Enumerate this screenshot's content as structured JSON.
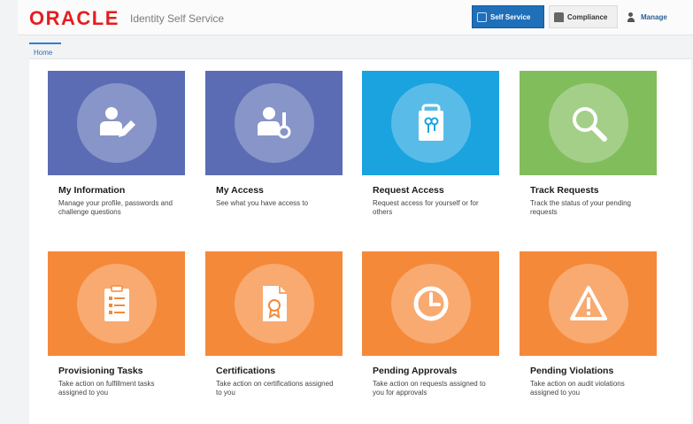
{
  "header": {
    "logo": "ORACLE",
    "app_title": "Identity Self Service",
    "nav": {
      "self_service": "Self Service",
      "compliance": "Compliance",
      "manage": "Manage"
    }
  },
  "tabs": {
    "home": "Home"
  },
  "tiles": [
    {
      "title": "My Information",
      "desc": "Manage your profile, passwords and challenge questions",
      "color": "#5b6cb4",
      "icon": "user-edit-icon"
    },
    {
      "title": "My Access",
      "desc": "See what you have access to",
      "color": "#5b6cb4",
      "icon": "user-key-icon"
    },
    {
      "title": "Request Access",
      "desc": "Request access for yourself or for others",
      "color": "#1aa3df",
      "icon": "shopping-bag-key-icon"
    },
    {
      "title": "Track Requests",
      "desc": "Track the status of your pending requests",
      "color": "#82bd5c",
      "icon": "magnifier-icon"
    },
    {
      "title": "Provisioning Tasks",
      "desc": "Take action on fulfillment tasks assigned to you",
      "color": "#f5893a",
      "icon": "clipboard-list-icon"
    },
    {
      "title": "Certifications",
      "desc": "Take action on certifications assigned to you",
      "color": "#f5893a",
      "icon": "certificate-document-icon"
    },
    {
      "title": "Pending Approvals",
      "desc": "Take action on requests assigned to you for approvals",
      "color": "#f5893a",
      "icon": "clock-icon"
    },
    {
      "title": "Pending Violations",
      "desc": "Take action on audit violations assigned to you",
      "color": "#f5893a",
      "icon": "warning-triangle-icon"
    }
  ]
}
